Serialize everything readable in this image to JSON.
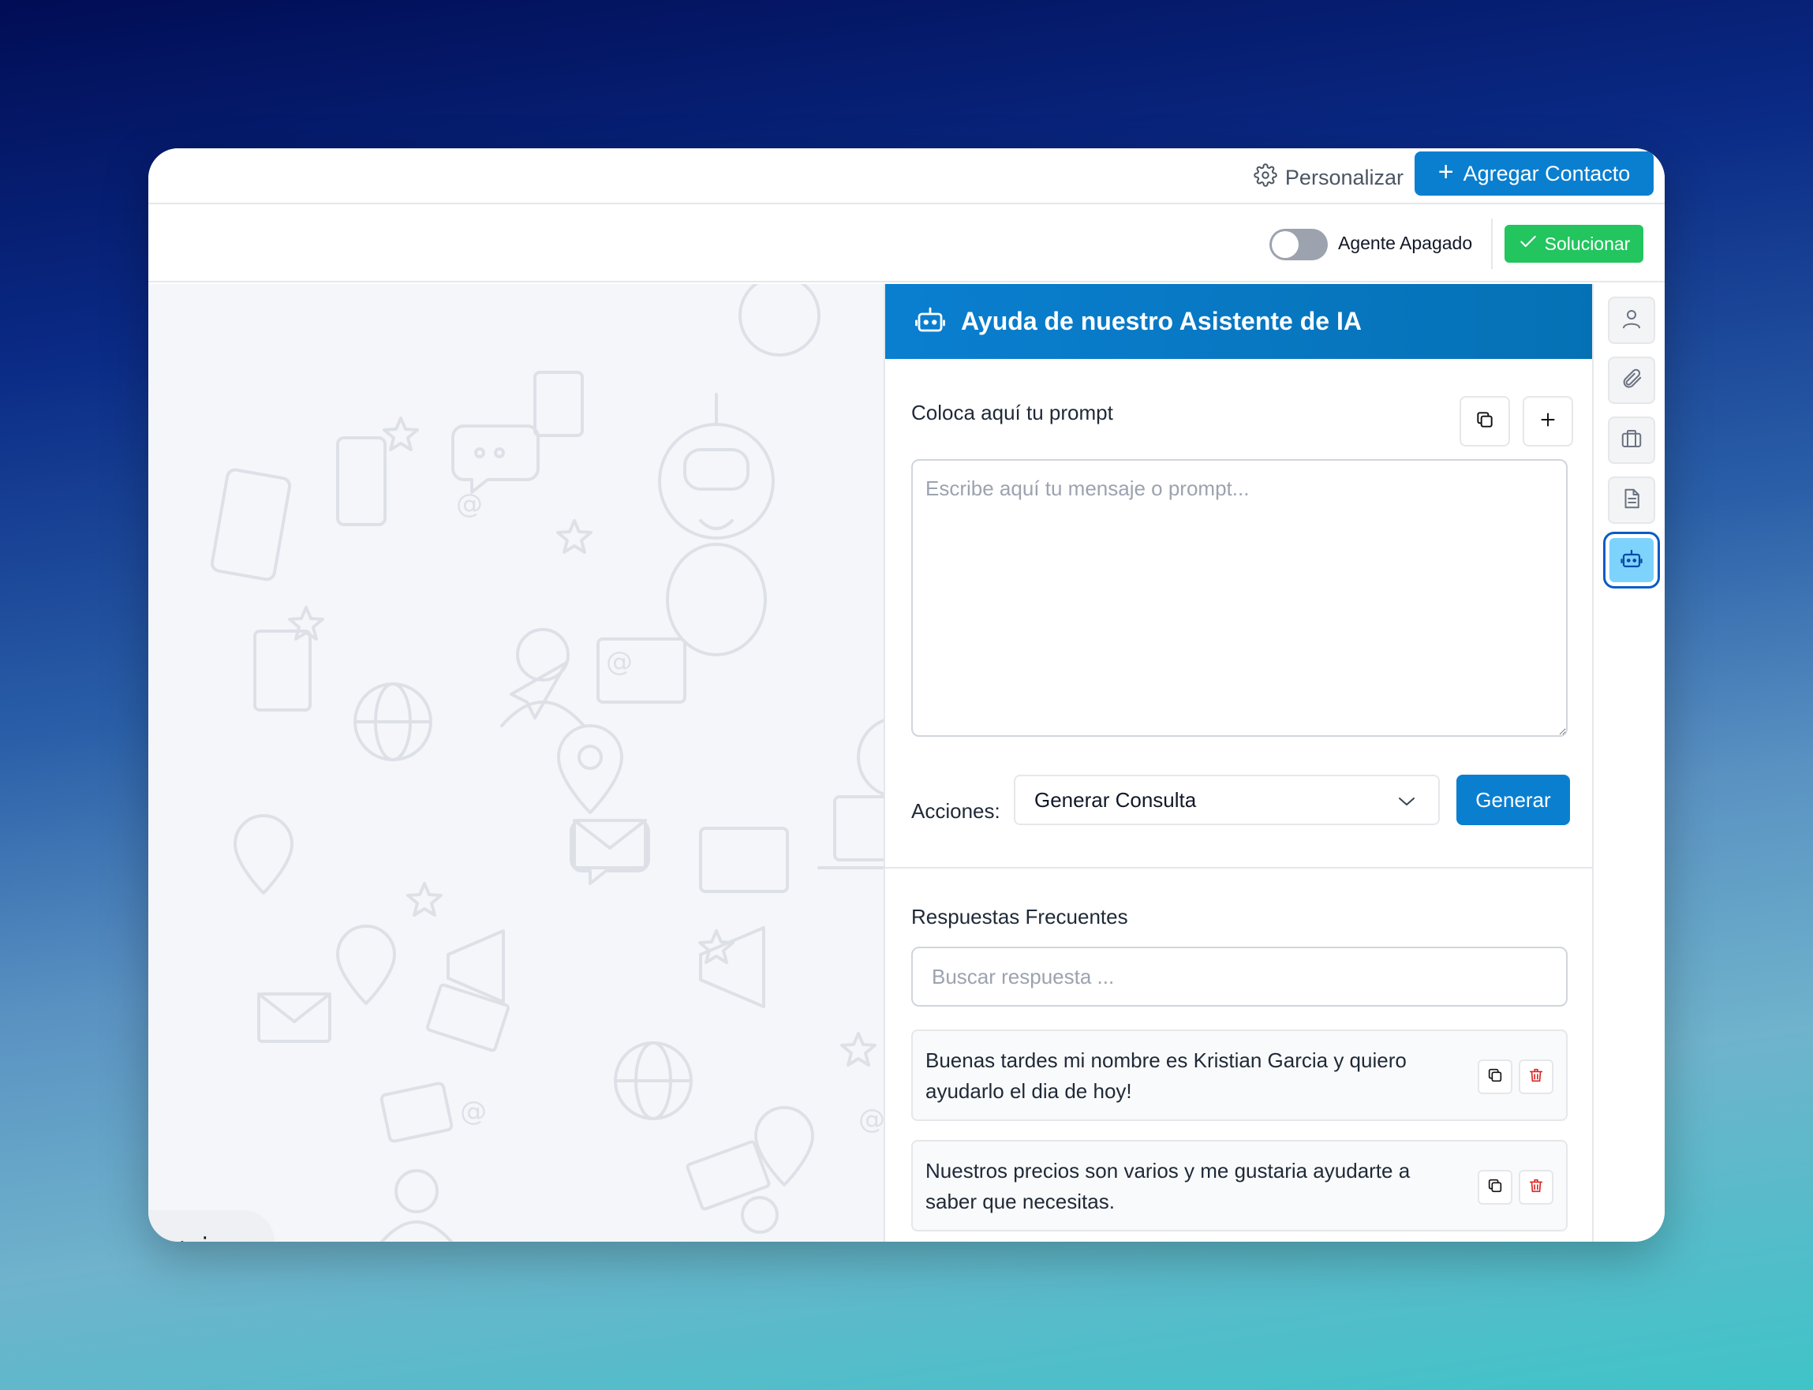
{
  "topbar": {
    "personalizar_label": "Personalizar",
    "agregar_label": "Agregar Contacto"
  },
  "subbar": {
    "agent_toggle_label": "Agente Apagado",
    "agent_toggle_on": false,
    "solucionar_label": "Solucionar"
  },
  "ai_panel": {
    "title": "Ayuda de nuestro Asistente de IA",
    "prompt_label": "Coloca aquí tu prompt",
    "prompt_placeholder": "Escribe aquí tu mensaje o prompt...",
    "actions_label": "Acciones:",
    "actions_selected": "Generar Consulta",
    "generate_label": "Generar",
    "frequent_title": "Respuestas Frecuentes",
    "search_placeholder": "Buscar respuesta ...",
    "responses": [
      {
        "text": "Buenas tardes mi nombre es Kristian Garcia y quiero ayudarlo el dia de hoy!"
      },
      {
        "text": "Nuestros precios son varios y me gustaria ayudarte a saber que necesitas."
      }
    ]
  },
  "rail": {
    "items": [
      "user-icon",
      "paperclip-icon",
      "briefcase-icon",
      "document-icon",
      "robot-icon"
    ],
    "active": "robot-icon"
  },
  "colors": {
    "primary": "#0a7fd0",
    "success": "#22c55e",
    "danger": "#dc2626",
    "rail_active": "#7dd3fc"
  }
}
